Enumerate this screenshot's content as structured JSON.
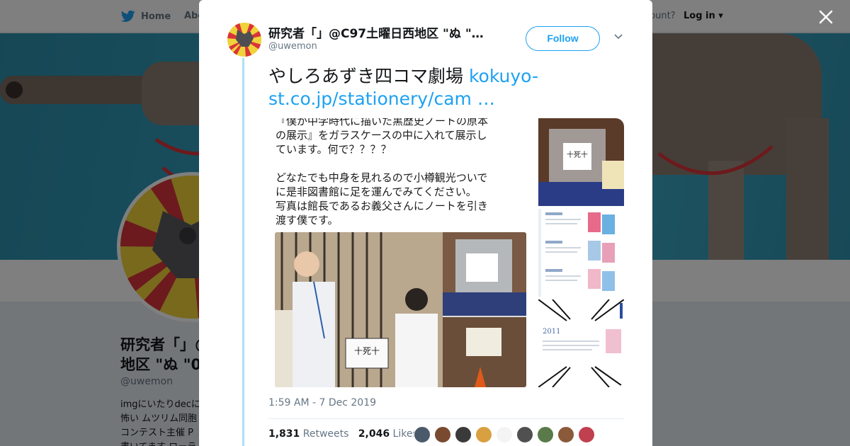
{
  "nav": {
    "home": "Home",
    "about": "Abo",
    "account_prompt": "count?",
    "login": "Log in"
  },
  "profile": {
    "name_line1": "研究者「」@",
    "name_line2": "地区 \"ぬ \"0",
    "handle": "@uwemon",
    "bio_lines": [
      "imgにいたりdecに",
      "怖い ムツリム同胞",
      "コンテスト主催 P",
      "書いてます ローラ"
    ]
  },
  "tweet": {
    "display_name": "研究者「」@C97土曜日西地区 \"ぬ \"…",
    "handle": "@uwemon",
    "follow_label": "Follow",
    "text_main": "やしろあずき四コマ劇場 ",
    "text_link": "kokuyo-st.co.jp/stationery/cam …",
    "image_text_lines": [
      "『僕が中学時代に描いた黒歴史ノートの原本",
      "の展示』をガラスケースの中に入れて展示し",
      "ています。何で？？？？",
      "",
      "どなたでも中身を見れるので小樽観光ついで",
      "に是非図書館に足を運んでみてください。",
      "写真は館長であるお義父さんにノートを引き",
      "渡す僕です。"
    ],
    "timestamp": "1:59 AM - 7 Dec 2019",
    "retweets_count": "1,831",
    "retweets_label": "Retweets",
    "likes_count": "2,046",
    "likes_label": "Likes"
  },
  "icons": {
    "close": "close-icon",
    "chevron": "chevron-down-icon",
    "bird": "twitter-bird-icon"
  },
  "colors": {
    "brand": "#1da1f2",
    "banner": "#36a2bf",
    "thread_line": "#ade0f9"
  }
}
